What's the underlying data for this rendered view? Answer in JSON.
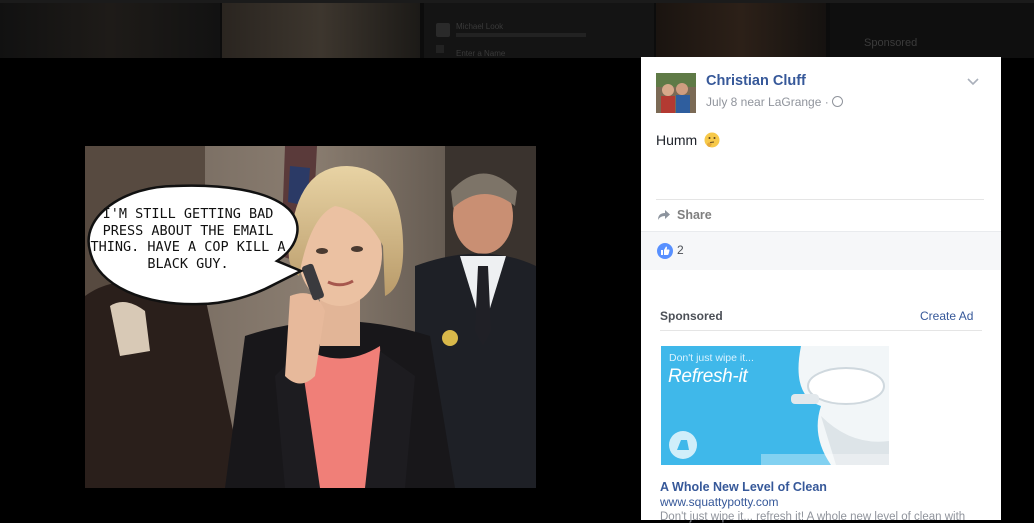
{
  "background": {
    "blurred_name": "Michael Look",
    "blurred_action": "Enter a Name",
    "blurred_sponsored": "Sponsored"
  },
  "photo": {
    "speech_bubble": "I'M STILL GETTING BAD PRESS ABOUT THE EMAIL THING. HAVE A COP KILL A BLACK GUY."
  },
  "post": {
    "author": "Christian Cluff",
    "meta": "July 8 near LaGrange ·",
    "text": "Humm",
    "share_label": "Share",
    "like_count": "2"
  },
  "sponsored": {
    "label": "Sponsored",
    "create_ad": "Create Ad",
    "ad_tagline": "Don't just wipe it...",
    "ad_brand": "Refresh-it",
    "ad_title": "A Whole New Level of Clean",
    "ad_url": "www.squattypotty.com",
    "ad_description": "Don't just wipe it... refresh it! A whole new level of clean with"
  },
  "colors": {
    "link_blue": "#365899",
    "like_blue": "#5890ff",
    "ad_blue": "#3fb8ea"
  }
}
